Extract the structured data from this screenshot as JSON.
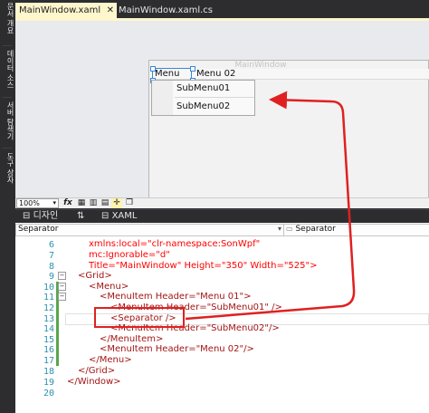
{
  "sidebar": {
    "items": [
      {
        "label": "문서 개요"
      },
      {
        "label": "데이터 소스"
      },
      {
        "label": "서버 탐색기"
      },
      {
        "label": "도구 상자"
      }
    ]
  },
  "tabs": [
    {
      "label": "MainWindow.xaml",
      "active": true
    },
    {
      "label": "MainWindow.xaml.cs",
      "active": false
    }
  ],
  "designer": {
    "window_title": "MainWindow",
    "menu_items": [
      "Menu 01",
      "Menu 02"
    ],
    "submenu_items": [
      "SubMenu01",
      "SubMenu02"
    ]
  },
  "toolbar": {
    "zoom": "100%",
    "fx_icon": "fx"
  },
  "switchbar": {
    "design_label": "디자인",
    "swap_icon": "⇅",
    "xaml_label": "XAML"
  },
  "dropdowns": {
    "left": "Separator",
    "right": "Separator"
  },
  "editor": {
    "lines": [
      {
        "num": "6",
        "code": "xmlns:local=\"clr-namespace:SonWpf\""
      },
      {
        "num": "7",
        "code": "mc:Ignorable=\"d\""
      },
      {
        "num": "8",
        "code": "Title=\"MainWindow\" Height=\"350\" Width=\"525\">"
      },
      {
        "num": "9",
        "code": "<Grid>"
      },
      {
        "num": "10",
        "code": "<Menu>"
      },
      {
        "num": "11",
        "code": "<MenuItem Header=\"Menu 01\">"
      },
      {
        "num": "12",
        "code": "<MenuItem Header=\"SubMenu01\" />"
      },
      {
        "num": "13",
        "code": "<Separator />"
      },
      {
        "num": "14",
        "code": "<MenuItem Header=\"SubMenu02\"/>"
      },
      {
        "num": "15",
        "code": "</MenuItem>"
      },
      {
        "num": "16",
        "code": "<MenuItem Header=\"Menu 02\"/>"
      },
      {
        "num": "17",
        "code": "</Menu>"
      },
      {
        "num": "18",
        "code": "</Grid>"
      },
      {
        "num": "19",
        "code": "</Window>"
      },
      {
        "num": "20",
        "code": ""
      }
    ]
  },
  "colors": {
    "annotation": "#e02020",
    "active_tab": "#fef6cc",
    "chrome": "#2d2d30"
  }
}
